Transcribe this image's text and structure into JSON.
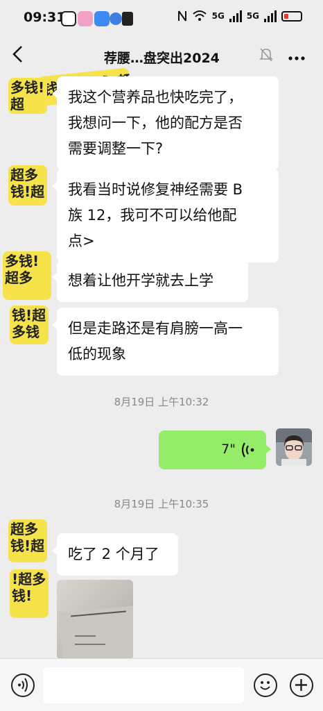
{
  "status_bar": {
    "time": "09:31",
    "net_label_1": "5G",
    "net_label_2": "5G"
  },
  "header": {
    "back_icon": "chevron-left-icon",
    "sticker_text": "钱!超多钱!超",
    "title": "荐腰…盘突出2024",
    "mute_icon": "bell-muted-icon",
    "more_icon": "more-dots-icon"
  },
  "messages": [
    {
      "type": "text",
      "text_lines": [
        "我这个营养品也快吃完了，",
        "我想问一下，他的配方是否",
        "需要调整一下?"
      ]
    },
    {
      "type": "text",
      "text_lines": [
        "我看当时说修复神经需要 B",
        "族 12，我可不可以给他配",
        "点>"
      ]
    },
    {
      "type": "text",
      "text_lines": [
        "想着让他开学就去上学"
      ]
    },
    {
      "type": "text",
      "text_lines": [
        "但是走路还是有肩膀一高一",
        "低的现象"
      ]
    }
  ],
  "timestamps": [
    "8月19日 上午10:32",
    "8月19日 上午10:35"
  ],
  "voice_message": {
    "duration": "7\"",
    "icon": "voice-wave-icon"
  },
  "later_messages": [
    {
      "type": "text",
      "text": "吃了 2 个月了"
    },
    {
      "type": "image",
      "icon": "photo-thumbnail"
    }
  ],
  "sticker_avatars": [
    "多钱!超",
    "超多钱!超",
    "多钱!超多",
    "钱!超多钱",
    "超多钱!超",
    "!超多钱!"
  ],
  "bottom_bar": {
    "voice_icon": "voice-input-icon",
    "emoji_icon": "emoji-icon",
    "plus_icon": "plus-icon"
  },
  "colors": {
    "background": "#ededed",
    "bubble_other": "#ffffff",
    "bubble_self": "#95ec69",
    "sticker": "#f6e24b",
    "timestamp": "#888888"
  }
}
